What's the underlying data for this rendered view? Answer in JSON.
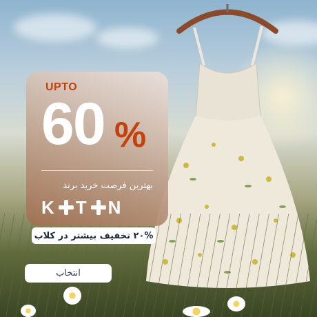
{
  "promo": {
    "upto_label": "UPTO",
    "discount_number": "60",
    "percent_sign": "%",
    "tagline": "بهترین فرصت خرید برند",
    "brand_name": "KOTON"
  },
  "discount_pill": {
    "label": "۲۰% تخفیف بیشتر در کلاب"
  },
  "cta": {
    "select_label": "انتخاب"
  },
  "colors": {
    "accent": "#c2410c",
    "card_bottom": "#a0704f",
    "button_bg": "#ffffff"
  }
}
